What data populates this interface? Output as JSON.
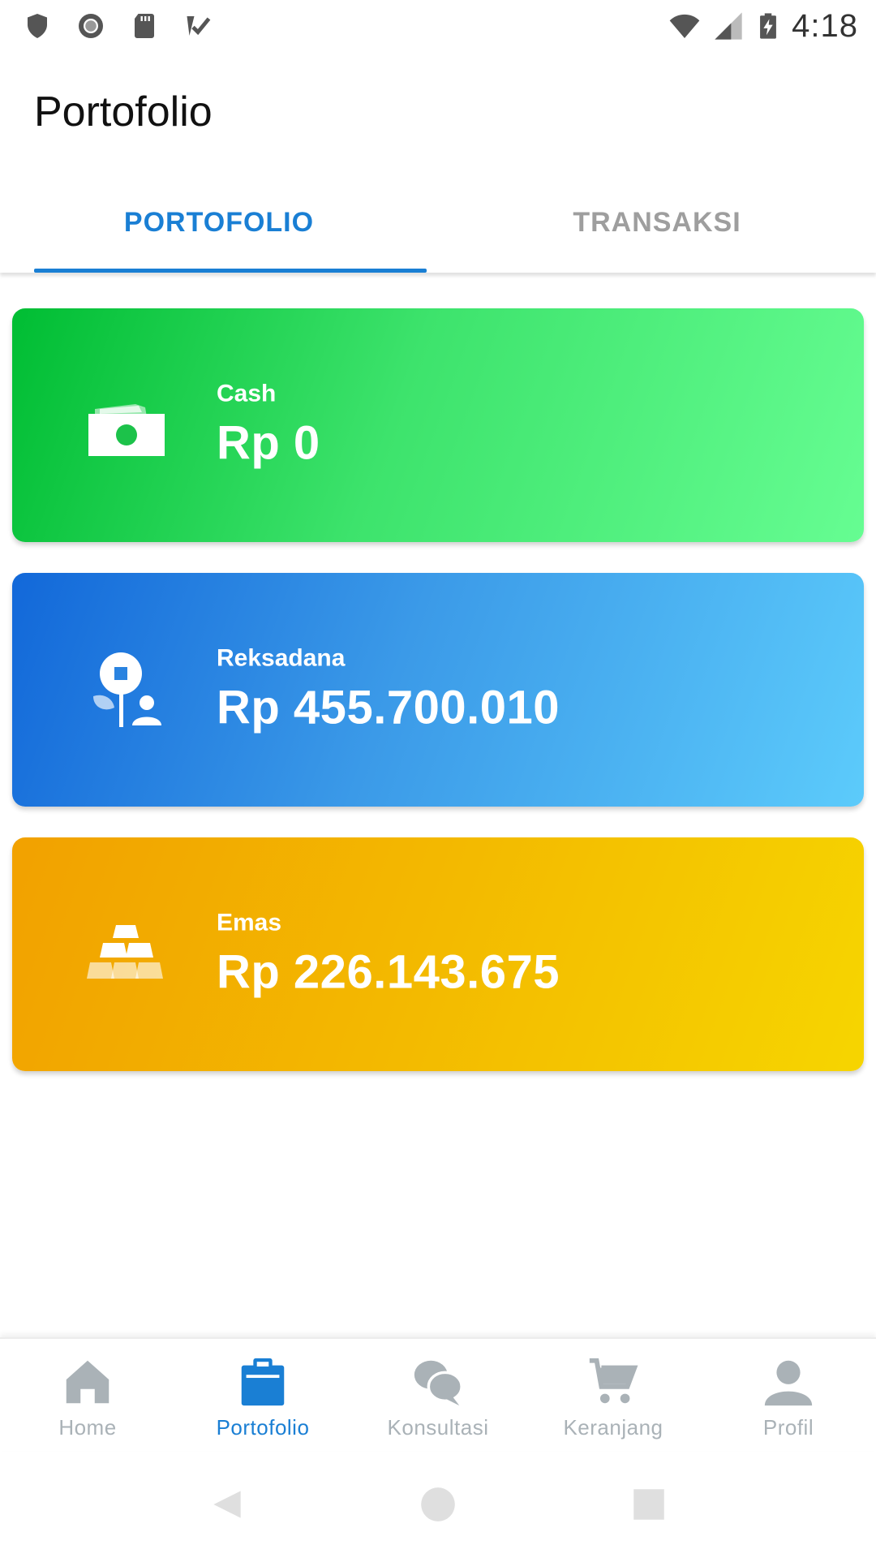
{
  "status_bar": {
    "time": "4:18",
    "left_icons": [
      "shield-icon",
      "record-icon",
      "sd-card-icon",
      "tasks-icon"
    ],
    "right_icons": [
      "wifi-icon",
      "signal-icon",
      "battery-charging-icon"
    ]
  },
  "appbar": {
    "title": "Portofolio"
  },
  "tabs": [
    {
      "label": "PORTOFOLIO",
      "active": true
    },
    {
      "label": "TRANSAKSI",
      "active": false
    }
  ],
  "cards": [
    {
      "label": "Cash",
      "value": "Rp 0",
      "icon": "money-icon",
      "gradient": [
        "#00bd33",
        "#66fd92"
      ]
    },
    {
      "label": "Reksadana",
      "value": "Rp 455.700.010",
      "icon": "mutual-fund-icon",
      "gradient": [
        "#1268d9",
        "#5ccbfb"
      ]
    },
    {
      "label": "Emas",
      "value": "Rp 226.143.675",
      "icon": "gold-bars-icon",
      "gradient": [
        "#f2a100",
        "#f6d500"
      ]
    }
  ],
  "bottom_nav": [
    {
      "label": "Home",
      "icon": "home-icon",
      "active": false
    },
    {
      "label": "Portofolio",
      "icon": "clipboard-icon",
      "active": true
    },
    {
      "label": "Konsultasi",
      "icon": "chat-icon",
      "active": false
    },
    {
      "label": "Keranjang",
      "icon": "cart-icon",
      "active": false
    },
    {
      "label": "Profil",
      "icon": "person-icon",
      "active": false
    }
  ],
  "colors": {
    "accent": "#1a7fd4",
    "inactive": "#aab2b7"
  }
}
